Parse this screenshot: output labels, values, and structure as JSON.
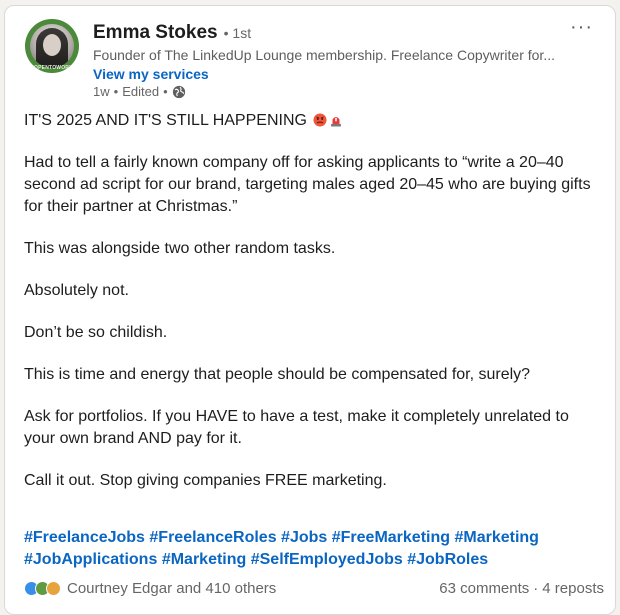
{
  "author": {
    "name": "Emma Stokes",
    "degree": "• 1st",
    "headline": "Founder of The LinkedUp Lounge membership. Freelance Copywriter for...",
    "services_link": "View my services",
    "time_ago": "1w",
    "separator1": "•",
    "edited": "Edited",
    "separator2": "•",
    "visibility_icon": "globe-icon",
    "avatar_badge": "#OPENTOWORK"
  },
  "menu": {
    "more_label": "···"
  },
  "post": {
    "paragraphs": [
      "IT'S 2025 AND IT'S STILL HAPPENING",
      "Had to tell a fairly known company off for asking applicants to “write a 20–40 second ad script for our brand, targeting males aged 20–45 who are buying gifts for their partner at Christmas.”",
      "This was alongside two other random tasks.",
      "Absolutely not.",
      "Don’t be so childish.",
      "This is time and energy that people should be compensated for, surely?",
      "Ask for portfolios. If you HAVE to have a test, make it completely unrelated to your own brand AND pay for it.",
      "Call it out. Stop giving companies FREE marketing."
    ],
    "title_emojis": [
      "angry-face-emoji",
      "siren-emoji"
    ],
    "hashtags": [
      "#FreelanceJobs",
      "#FreelanceRoles",
      "#Jobs",
      "#FreeMarketing",
      "#Marketing",
      "#JobApplications",
      "#Marketing",
      "#SelfEmployedJobs",
      "#JobRoles"
    ]
  },
  "social": {
    "reaction_icons": [
      "like-icon",
      "celebrate-icon",
      "insightful-icon"
    ],
    "reactors": "Courtney Edgar and 410 others",
    "comments": "63 comments",
    "dot": "·",
    "reposts": "4 reposts"
  },
  "colors": {
    "link_blue": "#0a66c2",
    "open_to_work_green": "#4a8a3a",
    "text_primary": "#1d1d1d",
    "text_secondary": "#666666"
  }
}
